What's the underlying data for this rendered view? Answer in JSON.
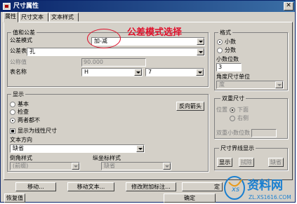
{
  "window": {
    "title": "尺寸属性"
  },
  "tabs": [
    {
      "label": "属性"
    },
    {
      "label": "尺寸文本"
    },
    {
      "label": "文本样式"
    }
  ],
  "tolerance": {
    "group_title": "值和公差",
    "mode_label": "公差模式",
    "mode_value": "加-减",
    "table_label": "公差表",
    "table_value": "孔",
    "nominal_label": "公称值",
    "nominal_value": "90.000",
    "table_name_label": "表名称",
    "table_name_value1": "H",
    "table_name_value2": "7"
  },
  "annotation": {
    "text": "公差模式选择",
    "color": "#e0102b"
  },
  "format": {
    "group_title": "格式",
    "options": [
      {
        "label": "小数",
        "selected": true
      },
      {
        "label": "分数",
        "selected": false
      }
    ],
    "decimal_places_label": "小数位数",
    "decimal_places_value": "3",
    "angle_unit_label": "角度尺寸单位",
    "angle_unit_value": "度"
  },
  "display": {
    "group_title": "显示",
    "options": [
      {
        "label": "基本",
        "selected": false
      },
      {
        "label": "检查",
        "selected": false
      },
      {
        "label": "两者都不",
        "selected": true
      }
    ],
    "flip_arrows": "反向箭头",
    "show_as_linear": "显示为线性尺寸",
    "text_direction_label": "文本方向",
    "text_direction_value": "缺省",
    "chamfer_style_label": "倒角样式",
    "chamfer_style_value": "(前缀)",
    "ordinate_style_label": "纵坐标样式",
    "ordinate_style_value": "缺省"
  },
  "dual": {
    "group_title": "双重尺寸",
    "position_label": "位置",
    "options": [
      {
        "label": "下面",
        "selected": true
      },
      {
        "label": "右侧",
        "selected": false
      }
    ],
    "dual_decimals_label": "双重小数位数"
  },
  "witness": {
    "group_title": "尺寸界线显示",
    "buttons": [
      "显示",
      "拭除",
      "缺省"
    ]
  },
  "bottom": {
    "move": "移动...",
    "move_text": "移动文本...",
    "modify_attach": "修改附加标注...",
    "fix": "定",
    "restore": "恢复值",
    "ok": "确定"
  },
  "watermark": {
    "text": "资料网",
    "url": "ZL.XS1616.COM",
    "color": "#1a7fd0"
  }
}
